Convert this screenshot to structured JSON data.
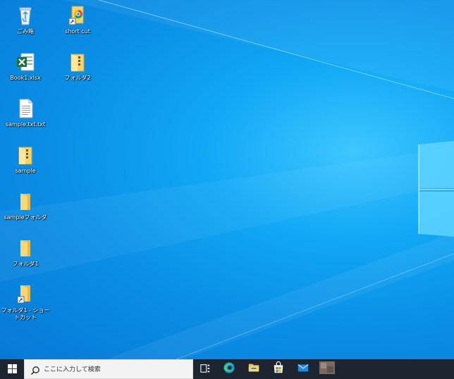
{
  "desktop": {
    "icons": [
      {
        "label": "ごみ箱",
        "icon": "recycle-bin-icon"
      },
      {
        "label": "short cut",
        "icon": "shortcut-folder-icon"
      },
      {
        "label": "Book1.xlsx",
        "icon": "excel-file-icon"
      },
      {
        "label": "フォルダ2",
        "icon": "zipped-folder-icon"
      },
      {
        "label": "sample.txt.txt",
        "icon": "text-file-icon"
      },
      {
        "label": "sample",
        "icon": "zipped-folder-icon"
      },
      {
        "label": "sampleフォルダ",
        "icon": "folder-icon"
      },
      {
        "label": "フォルダ1",
        "icon": "folder-icon"
      },
      {
        "label": "フォルダ1 - ショートカット",
        "icon": "folder-shortcut-icon"
      }
    ]
  },
  "taskbar": {
    "start_icon": "windows-logo-icon",
    "search": {
      "placeholder": "ここに入力して検索",
      "icon": "search-icon"
    },
    "apps": [
      {
        "name": "task-view",
        "icon": "task-view-icon"
      },
      {
        "name": "edge",
        "icon": "edge-icon"
      },
      {
        "name": "file-explorer",
        "icon": "file-explorer-icon"
      },
      {
        "name": "store",
        "icon": "store-icon"
      },
      {
        "name": "mail",
        "icon": "mail-icon"
      },
      {
        "name": "blurred-app",
        "icon": "app-icon"
      }
    ]
  },
  "colors": {
    "wallpaper_blue": "#0a8fe6",
    "taskbar": "#1c2530",
    "search_bg": "#f3f3f3",
    "folder_yellow": "#f6d36b"
  }
}
